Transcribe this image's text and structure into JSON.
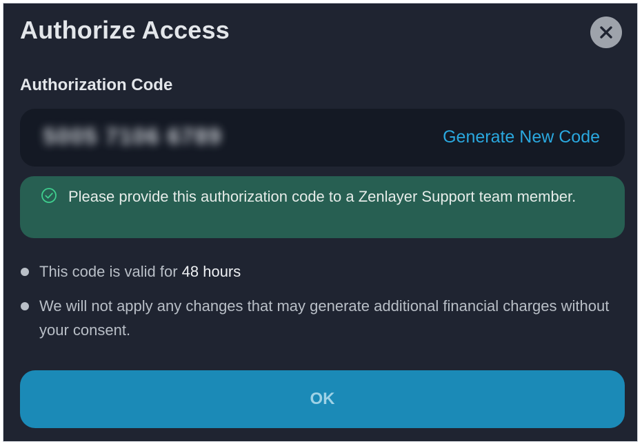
{
  "dialog": {
    "title": "Authorize Access",
    "close_icon": "close-icon"
  },
  "authorization": {
    "label": "Authorization Code",
    "code_value": "5005 7106 6789",
    "code_blurred": true,
    "generate_link": "Generate New Code"
  },
  "notice": {
    "icon": "check-circle-icon",
    "text": "Please provide this authorization code to a Zenlayer Support team member."
  },
  "info": {
    "validity_prefix": "This code is valid for ",
    "validity_value": "48 hours",
    "charges_text": "We will not apply any changes that may generate additional financial charges without your consent."
  },
  "actions": {
    "ok_label": "OK"
  },
  "colors": {
    "background": "#1f2431",
    "code_box": "#141924",
    "link": "#2aa8df",
    "notice_bg": "#275f52",
    "notice_icon": "#3fcf8e",
    "ok_button": "#1b8ab7",
    "close_button": "#9ea3ab"
  }
}
